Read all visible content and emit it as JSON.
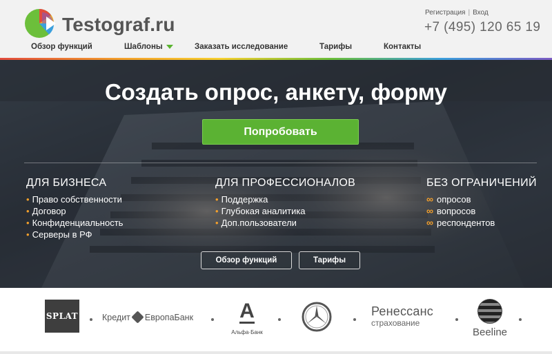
{
  "header": {
    "logo_text": "Testograf.ru",
    "register_label": "Регистрация",
    "separator": "|",
    "login_label": "Вход",
    "phone": "+7 (495) 120 65 19",
    "nav": [
      {
        "label": "Обзор функций"
      },
      {
        "label": "Шаблоны"
      },
      {
        "label": "Заказать исследование"
      },
      {
        "label": "Тарифы"
      },
      {
        "label": "Контакты"
      }
    ]
  },
  "hero": {
    "title": "Создать опрос, анкету, форму",
    "try_button": "Попробовать",
    "columns": [
      {
        "title": "ДЛЯ БИЗНЕСА",
        "items": [
          "Право собственности",
          "Договор",
          "Конфиденциальность",
          "Серверы в РФ"
        ]
      },
      {
        "title": "ДЛЯ ПРОФЕССИОНАЛОВ",
        "items": [
          "Поддержка",
          "Глубокая аналитика",
          "Доп.пользователи"
        ]
      },
      {
        "title": "БЕЗ ОГРАНИЧЕНИЙ",
        "items": [
          "опросов",
          "вопросов",
          "респондентов"
        ]
      }
    ],
    "features_button": "Обзор функций",
    "pricing_button": "Тарифы"
  },
  "partners": {
    "splat": "SPLAT",
    "credit_europe_left": "Кредит",
    "credit_europe_right": "ЕвропаБанк",
    "alfa_letter": "А",
    "alfa_text": "Альфа·Банк",
    "renaissance_name": "Ренессанс",
    "renaissance_sub": "страхование",
    "beeline": "Beeline"
  },
  "colors": {
    "accent_green": "#5bb233",
    "accent_orange": "#f4a02b",
    "header_bg": "#f2f2f2"
  },
  "icons": {
    "logo": "pie-chart-logo-icon",
    "nav_caret": "caret-down-icon",
    "bullet": "bullet-dot-icon",
    "infinity": "infinity-icon"
  }
}
